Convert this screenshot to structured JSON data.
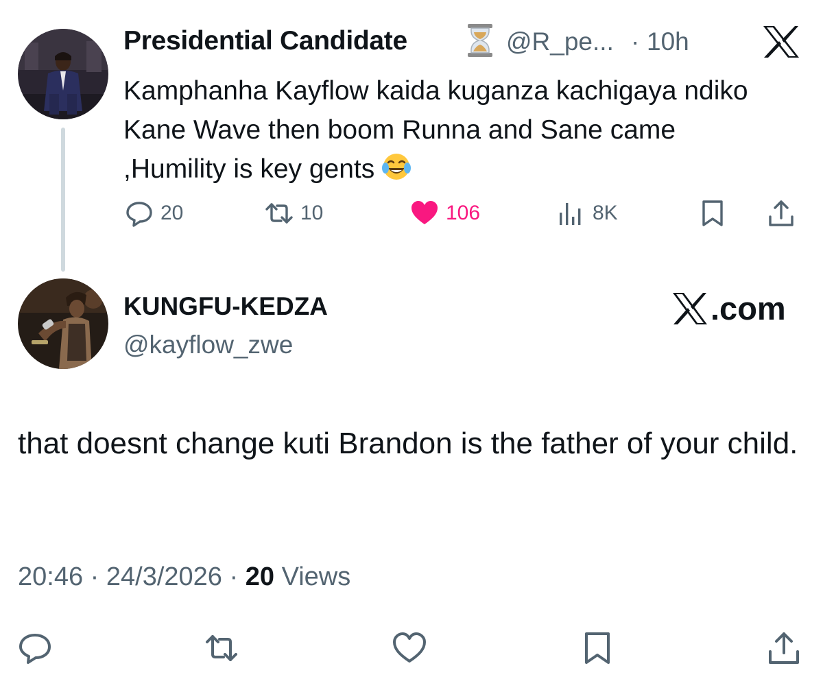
{
  "parent_tweet": {
    "display_name": "Presidential Candidate",
    "name_badge_icon": "hourglass-icon",
    "handle": "@R_pe...",
    "separator": "·",
    "time": "10h",
    "text": "Kamphanha Kayflow kaida kuganza kachigaya ndiko Kane Wave then boom Runna and Sane came ,Humility is key gents",
    "text_emoji_icon": "laughing-tears-emoji-icon",
    "stats": {
      "replies": "20",
      "reposts": "10",
      "likes": "106",
      "views": "8K"
    },
    "like_color": "#f91880"
  },
  "reply_tweet": {
    "display_name": "KUNGFU-KEDZA",
    "handle": "@kayflow_zwe",
    "brand_label": ".com",
    "body": "that doesnt change kuti Brandon is the father of your child.",
    "time": "20:46",
    "date": "24/3/2026",
    "separator": "·",
    "views_count": "20",
    "views_label": "Views"
  },
  "colors": {
    "text_primary": "#0f1419",
    "text_secondary": "#536471",
    "thread_line": "#cfd9de"
  }
}
